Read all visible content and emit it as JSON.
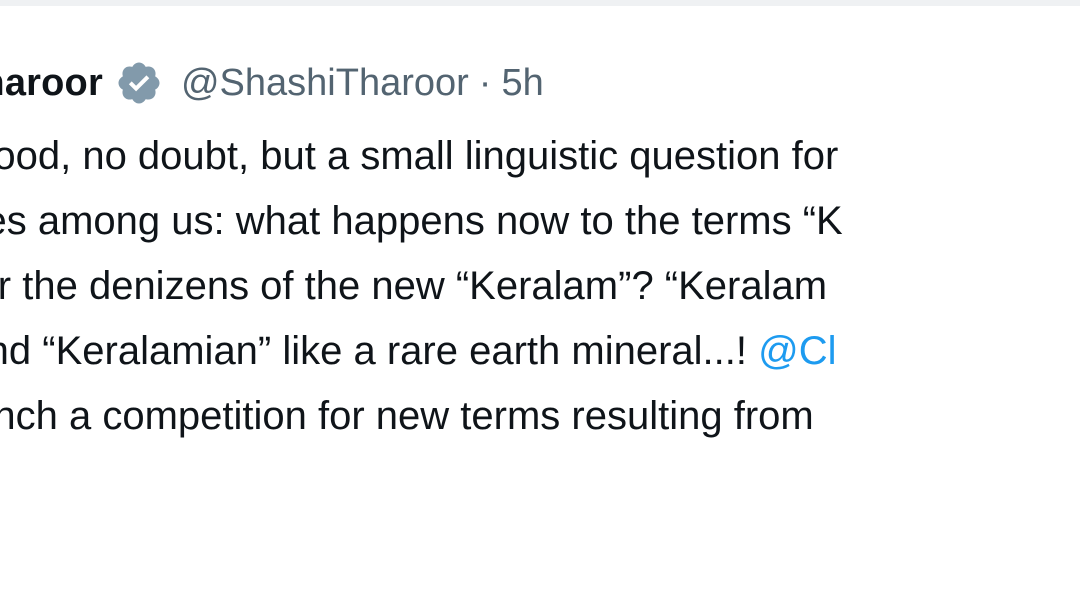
{
  "tweet": {
    "author_name": "Tharoor",
    "handle": "@ShashiTharoor",
    "separator": "·",
    "time": "5h",
    "verified_color": "#829aab",
    "lines": [
      "s good, no doubt, but a small linguistic question for",
      "ones among us: what happens now to the terms “K",
      "” for the denizens of the new “Keralam”? “Keralam",
      "” and “Keralamian” like a rare earth mineral...! ",
      "launch a competition for new terms resulting from"
    ],
    "mention": "@Cl"
  },
  "colors": {
    "text": "#0f1419",
    "secondary": "#536471",
    "link": "#1d9bf0"
  }
}
